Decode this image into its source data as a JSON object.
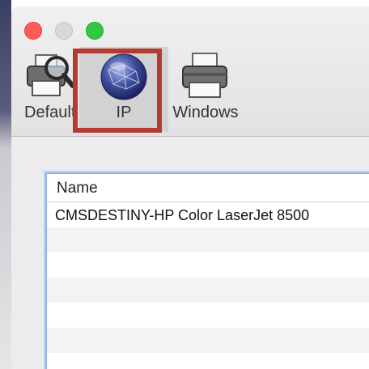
{
  "toolbar": {
    "default_label": "Default",
    "ip_label": "IP",
    "windows_label": "Windows"
  },
  "list": {
    "column_header": "Name",
    "rows": [
      "CMSDESTINY-HP Color LaserJet 8500",
      "",
      "",
      "",
      "",
      "",
      ""
    ]
  },
  "colors": {
    "highlight": "#b53a32",
    "close": "#fc5b57",
    "zoom": "#33c748",
    "list_focus": "#8fb4e6"
  }
}
